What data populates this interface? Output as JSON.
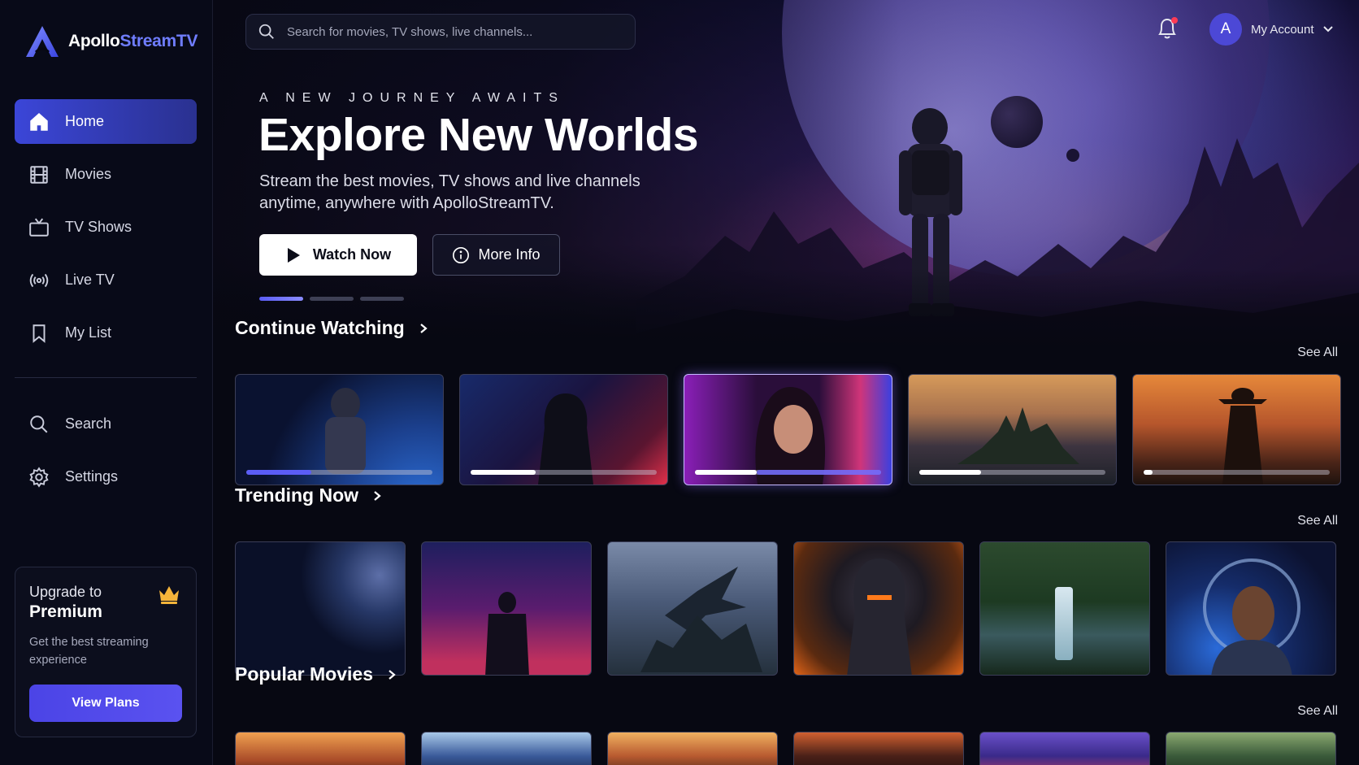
{
  "app": {
    "name_part1": "Apollo",
    "name_part2": "StreamTV"
  },
  "sidebar": {
    "items": [
      {
        "label": "Home",
        "icon": "home-icon",
        "active": true
      },
      {
        "label": "Movies",
        "icon": "film-icon"
      },
      {
        "label": "TV Shows",
        "icon": "tv-icon"
      },
      {
        "label": "Live TV",
        "icon": "broadcast-icon"
      },
      {
        "label": "My List",
        "icon": "bookmark-icon"
      }
    ],
    "secondary": [
      {
        "label": "Search",
        "icon": "search-icon"
      },
      {
        "label": "Settings",
        "icon": "gear-icon"
      }
    ],
    "premium": {
      "line1": "Upgrade to",
      "line2": "Premium",
      "description": "Get the best streaming experience",
      "button": "View Plans",
      "icon": "crown-icon",
      "accent": "#f5b43a"
    }
  },
  "header": {
    "search_placeholder": "Search for movies, TV shows, live channels...",
    "account_initial": "A",
    "account_label": "My Account",
    "notification_icon": "bell-icon",
    "has_notification": true
  },
  "hero": {
    "eyebrow": "A NEW JOURNEY AWAITS",
    "title": "Explore New Worlds",
    "subtitle": "Stream the best movies, TV shows and live channels anytime, anywhere with ApolloStreamTV.",
    "primary_button": "Watch Now",
    "secondary_button": "More Info",
    "slides": 3,
    "active_slide": 1
  },
  "sections": {
    "continue_watching": {
      "title": "Continue Watching",
      "see_all": "See All",
      "items": [
        {
          "theme": "astronaut-earth",
          "progress": 0.35,
          "color": "#5b5df6"
        },
        {
          "theme": "hooded-cyberpunk",
          "progress": 0.35,
          "color": "#ffffff"
        },
        {
          "theme": "woman-neon",
          "progress": 0.33,
          "color": "#6a63ff"
        },
        {
          "theme": "castle-island",
          "progress": 0.33,
          "color": "#ffffff"
        },
        {
          "theme": "cowboy-sunset",
          "progress": 0.05,
          "color": "#ffffff"
        }
      ]
    },
    "trending_now": {
      "title": "Trending Now",
      "see_all": "See All",
      "items": [
        {
          "theme": "planet-space"
        },
        {
          "theme": "neon-city"
        },
        {
          "theme": "dragon-mountains"
        },
        {
          "theme": "armored-warrior"
        },
        {
          "theme": "jungle-waterfall"
        },
        {
          "theme": "astronaut-portrait"
        }
      ]
    },
    "popular_movies": {
      "title": "Popular Movies",
      "see_all": "See All",
      "items": [
        {
          "theme": "sunset-figure"
        },
        {
          "theme": "space-helmet"
        },
        {
          "theme": "fire-sky"
        },
        {
          "theme": "dark-warrior"
        },
        {
          "theme": "purple-helmet"
        },
        {
          "theme": "jungle-figure"
        }
      ]
    }
  }
}
